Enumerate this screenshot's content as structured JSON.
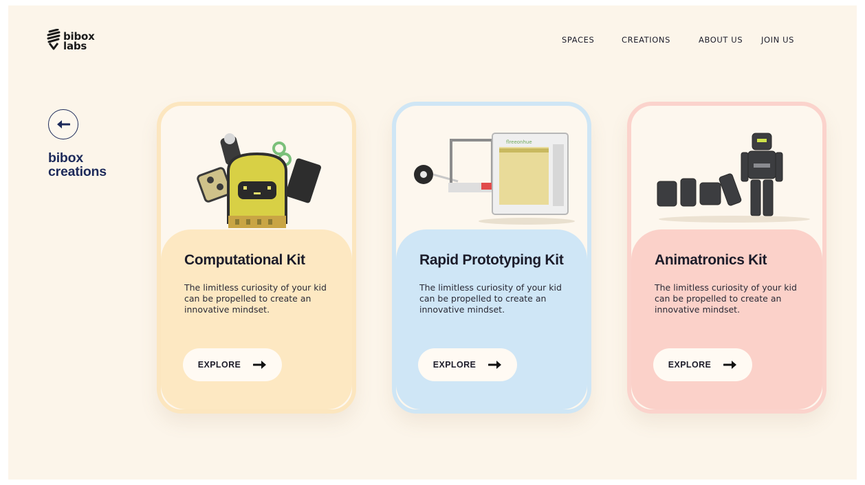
{
  "brand": {
    "line1": "bibox",
    "line2": "labs"
  },
  "nav": {
    "items": [
      "SPACES",
      "CREATIONS",
      "ABOUT US",
      "JOIN US"
    ]
  },
  "side": {
    "title_line1": "bibox",
    "title_line2": "creations",
    "back_icon": "arrow-left-icon"
  },
  "cards": [
    {
      "title": "Computational Kit",
      "description": "The limitless curiosity of your kid can be propelled to create an innovative mindset.",
      "button": "EXPLORE",
      "colors": {
        "border": "#fce6bf",
        "top": "#fdf7ee",
        "bottom": "#fde8c2"
      }
    },
    {
      "title": "Rapid Prototyping Kit",
      "description": "The limitless curiosity of your kid can be propelled to create an innovative mindset.",
      "button": "EXPLORE",
      "colors": {
        "border": "#cfe6f5",
        "top": "#fdf7ee",
        "bottom": "#cfe6f6"
      }
    },
    {
      "title": "Animatronics Kit",
      "description": "The limitless curiosity of your kid can be propelled to create an innovative mindset.",
      "button": "EXPLORE",
      "colors": {
        "border": "#fbd3cc",
        "top": "#fdf7ee",
        "bottom": "#fbd1c9"
      }
    }
  ]
}
